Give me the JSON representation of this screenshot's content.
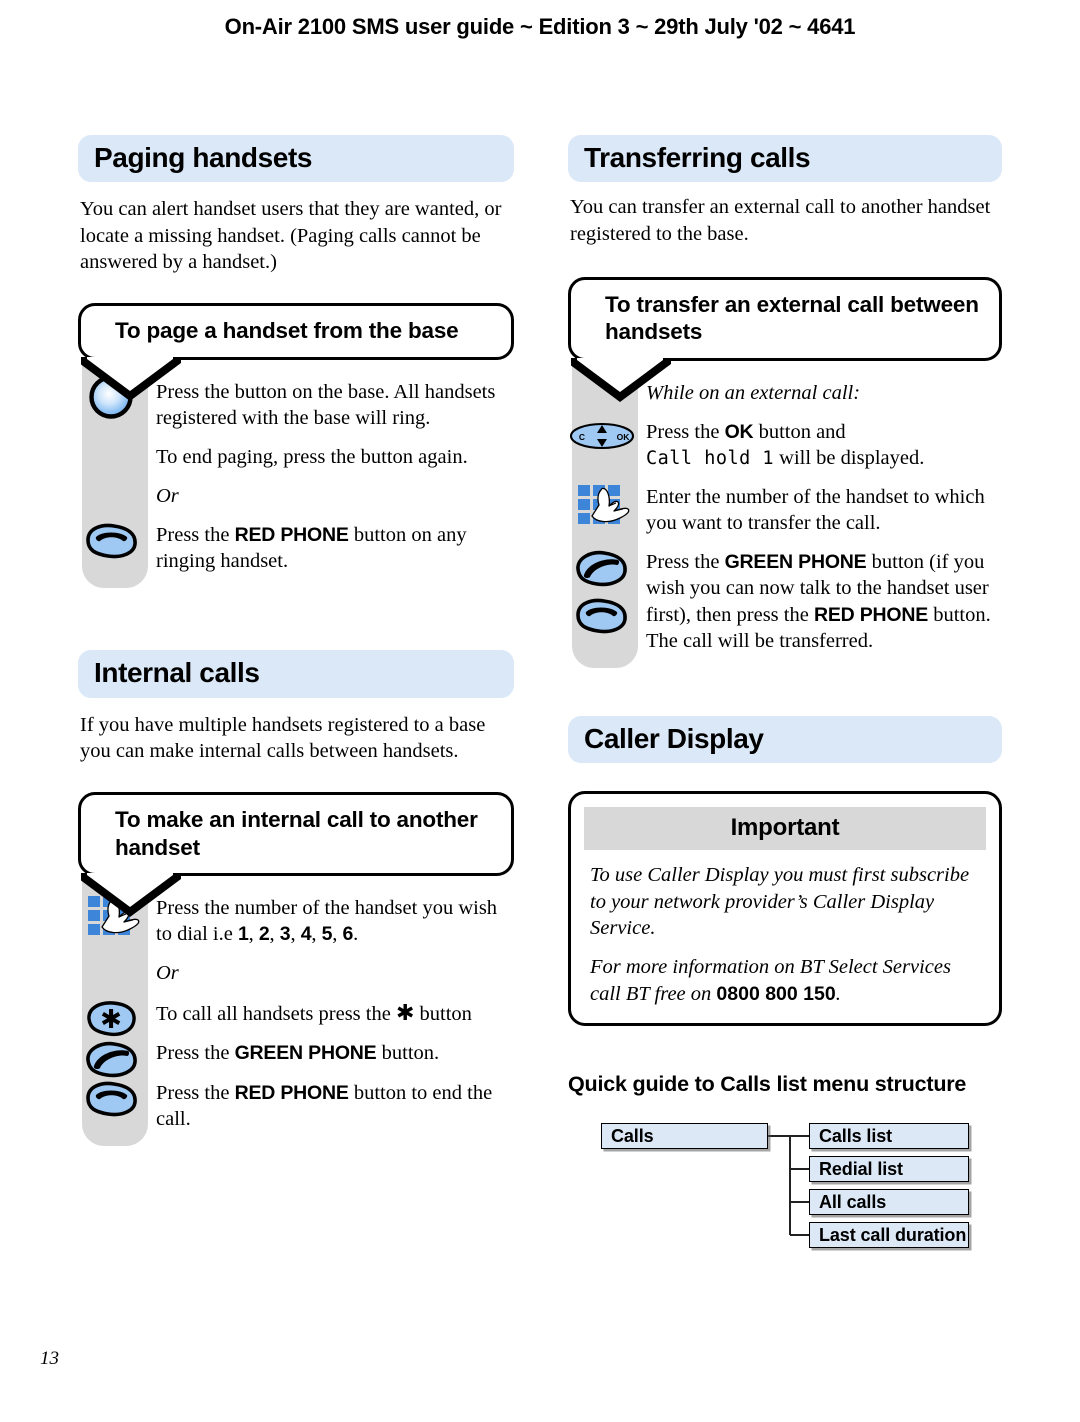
{
  "running_head": "On-Air 2100 SMS user guide ~ Edition 3 ~ 29th July '02 ~ 4641",
  "folio": "13",
  "left_column": {
    "sections": [
      {
        "heading": "Paging handsets",
        "intro": "You can alert handset users that they are wanted, or locate a missing handset. (Paging calls cannot be answered by a handset.)",
        "callout": "To page a handset from the base",
        "steps": [
          {
            "icon": "base-page-button-icon",
            "text_html": "Press the button on the base. All handsets registered with the base will ring."
          },
          {
            "icon": "none",
            "text_html": "To end paging, press the button again."
          },
          {
            "icon": "none",
            "text_html": "<i>Or</i>"
          },
          {
            "icon": "red-phone-button-icon",
            "text_html": "Press the <b>RED PHONE</b> button on any ringing handset."
          }
        ]
      },
      {
        "heading": "Internal calls",
        "intro": "If you have multiple handsets registered to a base you can make internal calls between handsets.",
        "callout": "To make an internal call to another handset",
        "steps": [
          {
            "icon": "keypad-icon",
            "text_html": "Press the number of the handset you wish to dial i.e <b>1</b>, <b>2</b>, <b>3</b>, <b>4</b>, <b>5</b>, <b>6</b>."
          },
          {
            "icon": "none",
            "text_html": "<i>Or</i>"
          },
          {
            "icon": "star-key-icon",
            "text_html": "To call all handsets press the &#10033; button"
          },
          {
            "icon": "green-phone-button-icon",
            "text_html": "Press the <b>GREEN PHONE</b> button."
          },
          {
            "icon": "red-phone-button-icon",
            "text_html": "Press the <b>RED PHONE</b> button to end the call."
          }
        ]
      }
    ]
  },
  "right_column": {
    "sections": [
      {
        "heading": "Transferring calls",
        "intro": "You can transfer an external call to another handset registered to the base.",
        "callout": "To transfer an external call between handsets",
        "steps": [
          {
            "icon": "none",
            "text_html": "<i>While on an external call:</i>"
          },
          {
            "icon": "nav-ok-key-icon",
            "text_html": "Press the <b>OK</b> button and<br><span class=\"lcd\">Call hold 1</span> will be displayed."
          },
          {
            "icon": "keypad-icon",
            "text_html": "Enter the number of the handset to which you want to transfer the call."
          },
          {
            "icon": "green-then-red-phone-icon",
            "text_html": "Press the <b>GREEN PHONE</b> button (if you wish you can now talk to the handset user first), then press the <b>RED PHONE</b> button. The call will be transferred."
          }
        ]
      },
      {
        "heading": "Caller Display",
        "important": {
          "title": "Important",
          "paragraphs": [
            "To use Caller Display you must first subscribe to your network provider's Caller Display Service.",
            "For more information on BT Select Services call BT free on <span class=\"num\">0800 800 150</span>."
          ]
        },
        "quick_guide": {
          "title": "Quick guide to Calls list menu structure",
          "root": "Calls",
          "children": [
            "Calls list",
            "Redial list",
            "All calls",
            "Last call duration"
          ]
        }
      }
    ]
  },
  "colors": {
    "heading_bar": "#dbe8f7",
    "gray_strip": "#d8d8d8",
    "icon_blue": "#9fc9f3",
    "keypad_blue": "#3d85d8",
    "node_fill": "#dce8f5"
  }
}
